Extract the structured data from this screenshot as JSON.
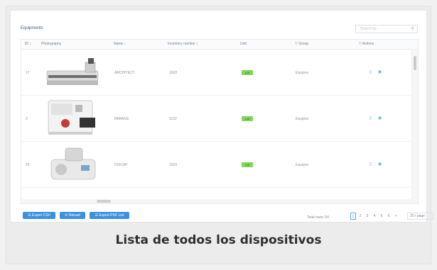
{
  "panel": {
    "title": "Equipments",
    "search_placeholder": "Search by..."
  },
  "columns": [
    {
      "key": "id",
      "label": "ID ↕"
    },
    {
      "key": "photo",
      "label": "Photography"
    },
    {
      "key": "name",
      "label": "Name ↕"
    },
    {
      "key": "inventory",
      "label": "Inventory number ↕"
    },
    {
      "key": "unit",
      "label": "Unit"
    },
    {
      "key": "group",
      "label": "▽  Group"
    },
    {
      "key": "actions",
      "label": "▽  Actions"
    }
  ],
  "rows": [
    {
      "id": "17",
      "name": "ARCHITECT",
      "inventory": "1920",
      "unit": "LAB",
      "group": "Equipos",
      "photo_icon": "analyzer-device-photo"
    },
    {
      "id": "3",
      "name": "IMMAGE",
      "inventory": "1122",
      "unit": "LAB",
      "group": "Equipos",
      "photo_icon": "analyzer-device-photo"
    },
    {
      "id": "16",
      "name": "DXICAP",
      "inventory": "1910",
      "unit": "LAB",
      "group": "Equipos",
      "photo_icon": "analyzer-device-photo"
    }
  ],
  "footer": {
    "total": "Total rows: 54",
    "pages": [
      "1",
      "2",
      "3",
      "4",
      "5",
      "6",
      ">"
    ],
    "active_page": "1",
    "per_page": "25 / page"
  },
  "buttons": {
    "export_csv": "☰ Export CSV",
    "reload": "⟳ Reload",
    "export_pdf": "☰ Export PDF List"
  },
  "caption": "Lista de todos los dispositivos",
  "colors": {
    "accent": "#3d8fe0",
    "badge": "#7ed957",
    "title": "#3b5a83"
  }
}
